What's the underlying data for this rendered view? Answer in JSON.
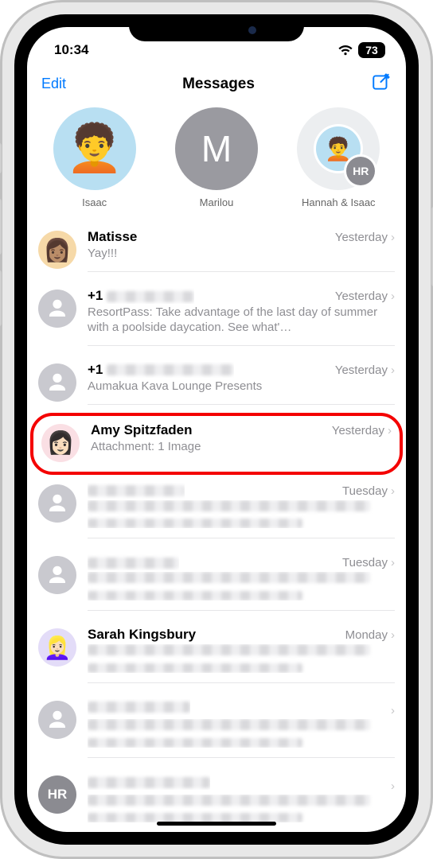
{
  "status": {
    "time": "10:34",
    "battery": "73"
  },
  "nav": {
    "edit": "Edit",
    "title": "Messages"
  },
  "pinned": [
    {
      "label": "Isaac",
      "avatar_type": "memoji-blue"
    },
    {
      "label": "Marilou",
      "avatar_type": "gray-letter",
      "initial": "M"
    },
    {
      "label": "Hannah & Isaac",
      "avatar_type": "group",
      "badge": "HR"
    }
  ],
  "conversations": [
    {
      "name": "Matisse",
      "preview": "Yay!!!",
      "time": "Yesterday",
      "avatar": "memoji-warm",
      "blurred_name": false,
      "blurred_preview": false
    },
    {
      "name": "+1",
      "preview": "ResortPass: Take advantage of the last day of summer with a poolside daycation. See what'…",
      "time": "Yesterday",
      "avatar": "silhouette",
      "blurred_name": true,
      "blurred_preview": false
    },
    {
      "name": "+1",
      "preview": "Aumakua Kava Lounge Presents",
      "time": "Yesterday",
      "avatar": "silhouette",
      "blurred_name": true,
      "blurred_preview": false
    },
    {
      "name": "Amy Spitzfaden",
      "preview": "Attachment: 1 Image",
      "time": "Yesterday",
      "avatar": "memoji-pink",
      "blurred_name": false,
      "blurred_preview": false,
      "highlighted": true
    },
    {
      "name": "",
      "preview": "",
      "time": "Tuesday",
      "avatar": "silhouette",
      "blurred_name": true,
      "blurred_preview": true
    },
    {
      "name": "",
      "preview": "",
      "time": "Tuesday",
      "avatar": "silhouette",
      "blurred_name": true,
      "blurred_preview": true
    },
    {
      "name": "Sarah Kingsbury",
      "preview": "",
      "time": "Monday",
      "avatar": "memoji-lilac",
      "blurred_name": false,
      "blurred_preview": true
    },
    {
      "name": "",
      "preview": "",
      "time": "",
      "avatar": "silhouette",
      "blurred_name": true,
      "blurred_preview": true
    },
    {
      "name": "",
      "preview": "",
      "time": "",
      "avatar": "letters",
      "initials": "HR",
      "blurred_name": true,
      "blurred_preview": true
    }
  ]
}
